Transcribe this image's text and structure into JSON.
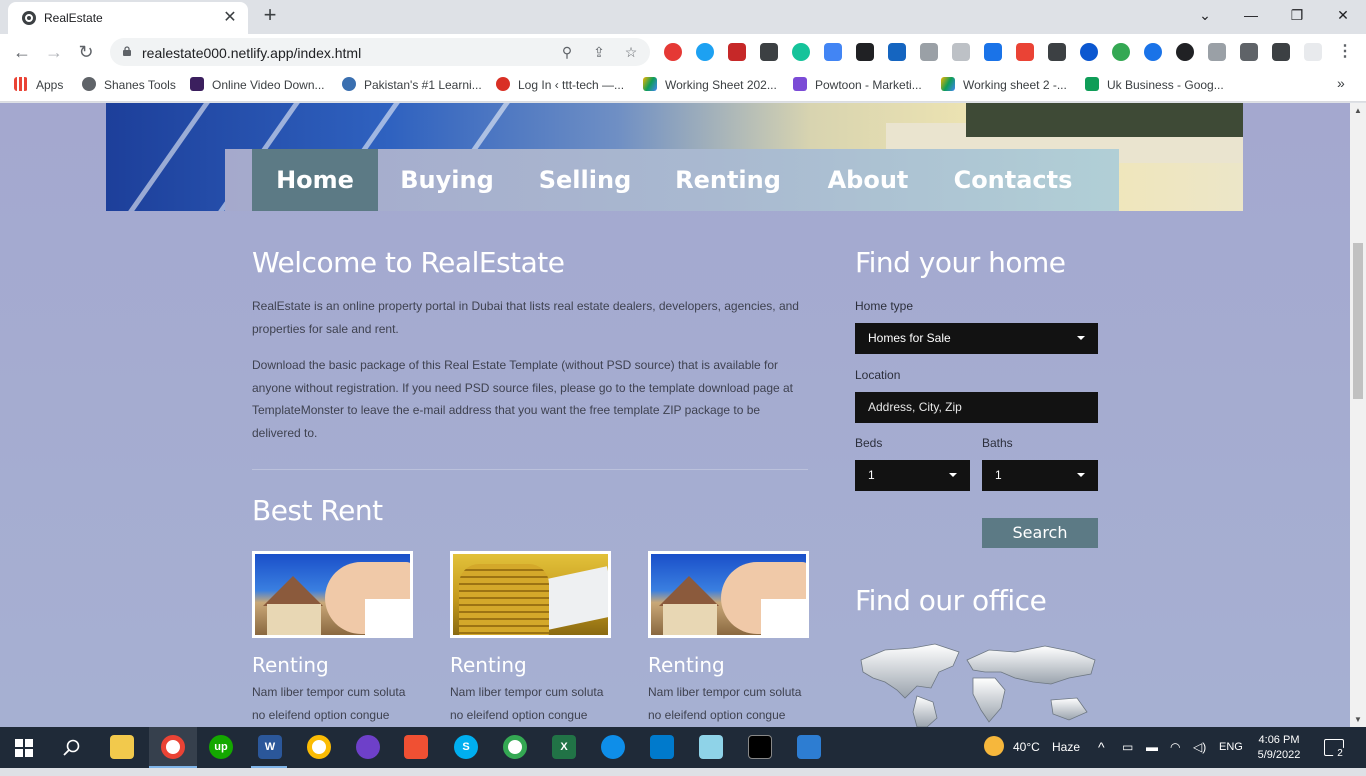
{
  "browser": {
    "tab_title": "RealEstate",
    "tab_close": "✕",
    "new_tab": "+",
    "window_controls": {
      "minimize": "—",
      "maximize": "❐",
      "close": "✕",
      "tab_search": "⌄"
    },
    "nav": {
      "back": "←",
      "forward": "→",
      "reload": "↻"
    },
    "url": "realestate000.netlify.app/index.html",
    "omnibox_icons": {
      "zoom": "⚲",
      "share": "⇪",
      "bookmark": "☆"
    },
    "bookmarks": [
      {
        "label": "Apps",
        "icon": "apps-grid-icon",
        "color": "#ea4335"
      },
      {
        "label": "Shanes Tools",
        "icon": "globe-icon",
        "color": "#5f6368"
      },
      {
        "label": "Online Video Down...",
        "icon": "q-logo-icon",
        "color": "#3b1f5e"
      },
      {
        "label": "Pakistan's #1 Learni...",
        "icon": "star-badge-icon",
        "color": "#3a6fb0"
      },
      {
        "label": "Log In ‹ ttt-tech —...",
        "icon": "swirl-icon",
        "color": "#d93025"
      },
      {
        "label": "Working Sheet 202...",
        "icon": "google-drive-icon",
        "color": "#f4b400"
      },
      {
        "label": "Powtoon - Marketi...",
        "icon": "powtoon-icon",
        "color": "#7b4bd6"
      },
      {
        "label": "Working sheet 2 -...",
        "icon": "google-drive-icon",
        "color": "#0f9d58"
      },
      {
        "label": "Uk Business - Goog...",
        "icon": "plus-square-icon",
        "color": "#0f9d58"
      }
    ],
    "bookmarks_more": "»"
  },
  "page": {
    "nav": [
      {
        "label": "Home",
        "active": true
      },
      {
        "label": "Buying",
        "active": false
      },
      {
        "label": "Selling",
        "active": false
      },
      {
        "label": "Renting",
        "active": false
      },
      {
        "label": "About",
        "active": false
      },
      {
        "label": "Contacts",
        "active": false
      }
    ],
    "welcome": {
      "title": "Welcome to RealEstate",
      "p1": "RealEstate is an online property portal in Dubai that lists real estate dealers, developers, agencies, and properties for sale and rent.",
      "p2": "Download the basic package of this Real Estate Template (without PSD source) that is available for anyone without registration. If you need PSD source files, please go to the template download page at TemplateMonster to leave the e-mail address that you want the free template ZIP package to be delivered to."
    },
    "best_rent": {
      "title": "Best Rent",
      "items": [
        {
          "caption": "Renting",
          "text": "Nam liber tempor cum soluta no eleifend option congue"
        },
        {
          "caption": "Renting",
          "text": "Nam liber tempor cum soluta no eleifend option congue"
        },
        {
          "caption": "Renting",
          "text": "Nam liber tempor cum soluta no eleifend option congue"
        }
      ]
    },
    "find_home": {
      "title": "Find your home",
      "home_type_label": "Home type",
      "home_type_value": "Homes for Sale",
      "location_label": "Location",
      "location_placeholder": "Address, City, Zip",
      "beds_label": "Beds",
      "beds_value": "1",
      "baths_label": "Baths",
      "baths_value": "1",
      "search_button": "Search"
    },
    "find_office": {
      "title": "Find our office"
    }
  },
  "taskbar": {
    "weather_temp": "40°C",
    "weather_desc": "Haze",
    "language": "ENG",
    "time": "4:06 PM",
    "date": "5/9/2022",
    "notification_count": "2",
    "chevron": "^"
  }
}
